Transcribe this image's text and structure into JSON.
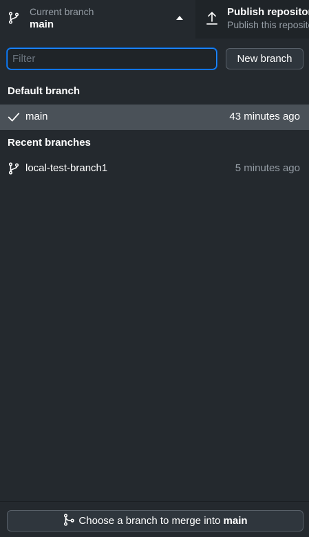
{
  "toolbar": {
    "branch": {
      "title": "Current branch",
      "value": "main",
      "icon": "git-branch-icon"
    },
    "publish": {
      "title": "Publish repository",
      "description": "Publish this repository to GitHub",
      "icon": "upload-icon"
    }
  },
  "filter": {
    "placeholder": "Filter",
    "value": ""
  },
  "new_branch_label": "New branch",
  "default_section": {
    "title": "Default branch",
    "items": [
      {
        "name": "main",
        "time": "43 minutes ago",
        "icon": "check-icon",
        "selected": true
      }
    ]
  },
  "recent_section": {
    "title": "Recent branches",
    "items": [
      {
        "name": "local-test-branch1",
        "time": "5 minutes ago",
        "icon": "git-branch-icon",
        "selected": false
      }
    ]
  },
  "merge": {
    "prefix": "Choose a branch to merge into ",
    "target": "main",
    "icon": "git-merge-icon"
  },
  "colors": {
    "background": "#24292e",
    "toolbar": "#1f2428",
    "selected_row": "#4a5158",
    "focus_border": "#2188ff",
    "muted_text": "#959da5"
  }
}
